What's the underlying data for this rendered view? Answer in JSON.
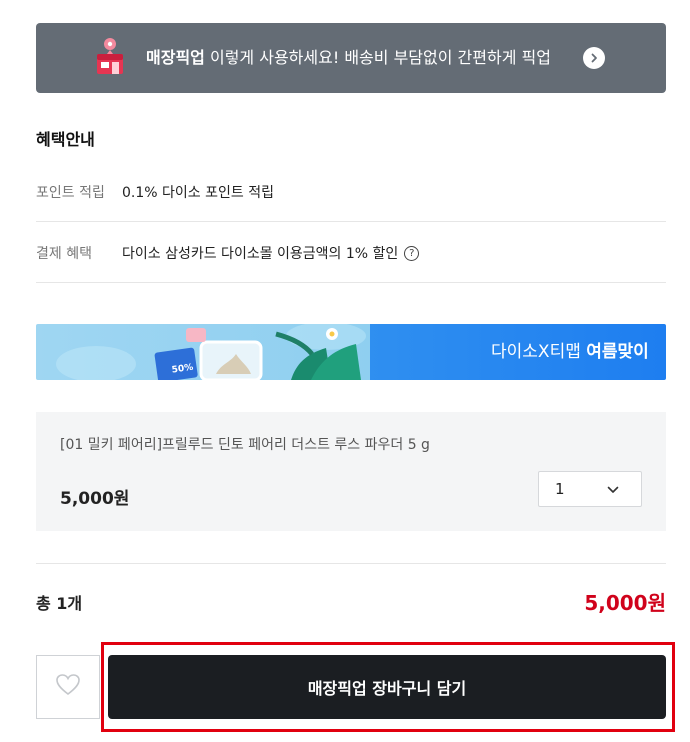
{
  "pickup_banner": {
    "bold": "매장픽업",
    "text": " 이렇게 사용하세요! 배송비 부담없이 간편하게 픽업",
    "icon": "store-pickup-icon",
    "arrow_icon": "chevron-right-icon"
  },
  "benefits": {
    "title": "혜택안내",
    "rows": [
      {
        "label": "포인트 적립",
        "value": "0.1% 다이소 포인트 적립"
      },
      {
        "label": "결제 혜택",
        "value": "다이소 삼성카드 다이소몰 이용금액의 1% 할인",
        "help": "?"
      }
    ]
  },
  "promo": {
    "text": "다이소X티맵 ",
    "bold": "여름맞이",
    "coupon_label": "50%"
  },
  "option": {
    "name": "[01 밀키 페어리]프릴루드 딘토 페어리 더스트 루스 파우더 5 g",
    "price": "5,000원",
    "quantity": "1"
  },
  "total": {
    "label": "총 1개",
    "price": "5,000원"
  },
  "actions": {
    "cart_label": "매장픽업 장바구니 담기",
    "wish_icon": "heart-icon"
  },
  "colors": {
    "pickup_banner_bg": "#646c75",
    "total_price": "#d0021b",
    "cart_button_bg": "#1b1e22",
    "highlight_border": "#e1000f"
  }
}
